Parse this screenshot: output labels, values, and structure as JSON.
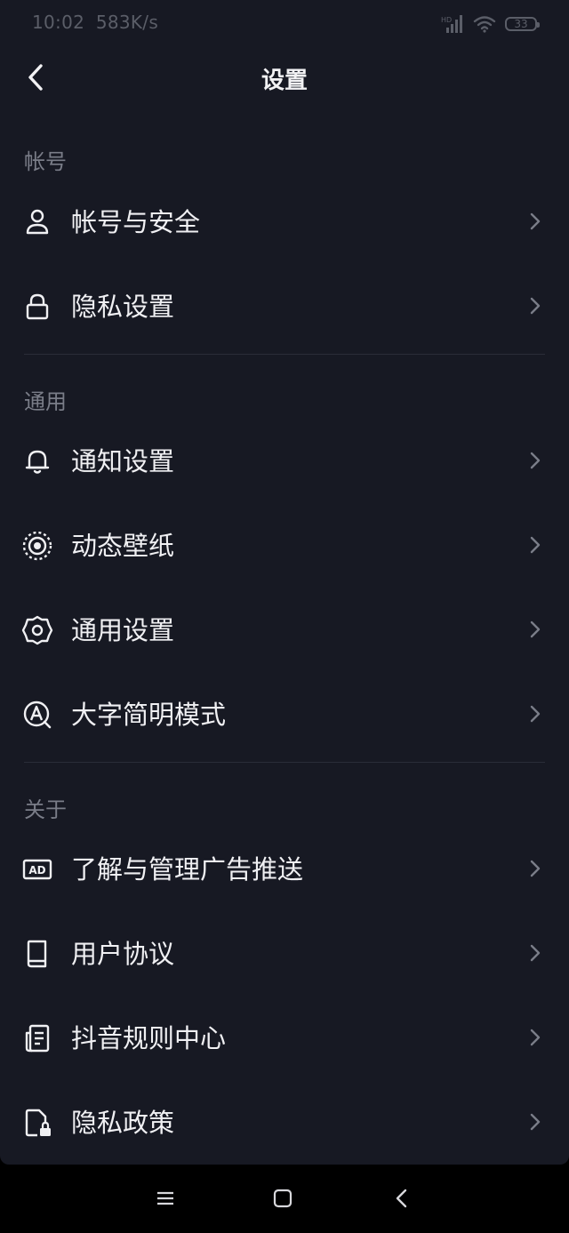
{
  "status_bar": {
    "time": "10:02",
    "speed": "583K/s",
    "network": "HD",
    "battery": "33"
  },
  "header": {
    "title": "设置"
  },
  "sections": [
    {
      "title": "帐号",
      "items": [
        {
          "label": "帐号与安全",
          "icon": "user-icon"
        },
        {
          "label": "隐私设置",
          "icon": "lock-icon"
        }
      ]
    },
    {
      "title": "通用",
      "items": [
        {
          "label": "通知设置",
          "icon": "bell-icon"
        },
        {
          "label": "动态壁纸",
          "icon": "wallpaper-icon"
        },
        {
          "label": "通用设置",
          "icon": "gear-icon"
        },
        {
          "label": "大字简明模式",
          "icon": "large-text-icon"
        }
      ]
    },
    {
      "title": "关于",
      "items": [
        {
          "label": "了解与管理广告推送",
          "icon": "ad-icon"
        },
        {
          "label": "用户协议",
          "icon": "book-icon"
        },
        {
          "label": "抖音规则中心",
          "icon": "document-list-icon"
        },
        {
          "label": "隐私政策",
          "icon": "privacy-file-icon"
        }
      ]
    }
  ],
  "ad_icon_text": "AD",
  "colors": {
    "background": "#171923",
    "text": "#f0f0f3",
    "section_title": "#7a7d88",
    "divider": "#2a2d38",
    "chevron": "#7a7d88"
  }
}
